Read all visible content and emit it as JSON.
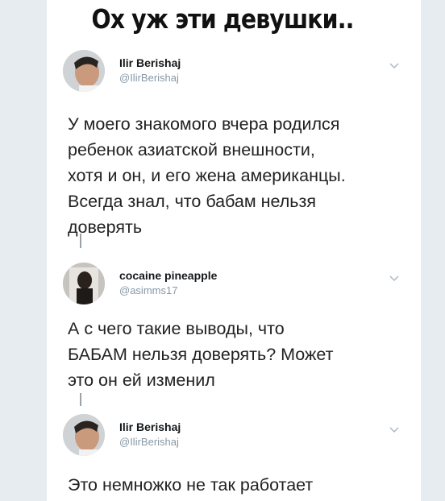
{
  "headline": "Ох уж эти девушки..",
  "tweets": [
    {
      "name": "Ilir Berishaj",
      "handle": "@IlirBerishaj",
      "avatar": "man-profile-photo",
      "text": "У моего знакомого вчера родился\nребенок азиатской внешности,\nхотя и он, и его жена американцы.\nВсегда знал, что бабам нельзя\nдоверять"
    },
    {
      "name": "cocaine pineapple",
      "handle": "@asimms17",
      "avatar": "woman-mirror-selfie-photo",
      "text": "А с чего такие выводы, что\nБАБАМ нельзя доверять? Может\nэто он ей изменил"
    },
    {
      "name": "Ilir Berishaj",
      "handle": "@IlirBerishaj",
      "avatar": "man-profile-photo",
      "text": "Это немножко не так работает"
    }
  ],
  "icons": {
    "menu": "chevron-down-icon"
  },
  "colors": {
    "name": "#14171a",
    "handle": "#8899a6",
    "text": "#222222",
    "side": "#e6ecf0"
  }
}
